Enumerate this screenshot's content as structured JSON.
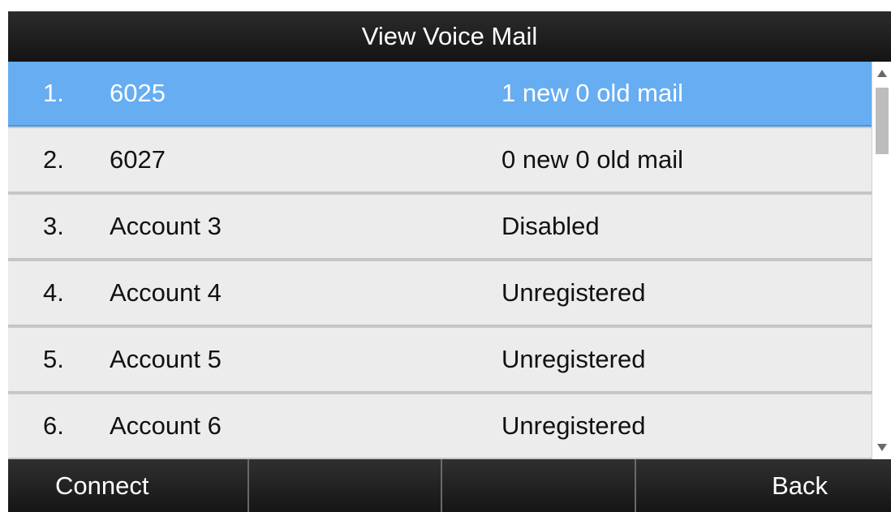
{
  "title": "View Voice Mail",
  "accounts": [
    {
      "num": "1.",
      "name": "6025",
      "status": "1 new 0 old mail",
      "selected": true
    },
    {
      "num": "2.",
      "name": "6027",
      "status": "0 new 0 old mail",
      "selected": false
    },
    {
      "num": "3.",
      "name": "Account 3",
      "status": "Disabled",
      "selected": false
    },
    {
      "num": "4.",
      "name": "Account 4",
      "status": "Unregistered",
      "selected": false
    },
    {
      "num": "5.",
      "name": "Account 5",
      "status": "Unregistered",
      "selected": false
    },
    {
      "num": "6.",
      "name": "Account 6",
      "status": "Unregistered",
      "selected": false
    }
  ],
  "softkeys": [
    "Connect",
    "",
    "",
    "Back"
  ],
  "colors": {
    "selected_row": "#66adf2",
    "row_background": "#ececec",
    "bar_background": "#1c1c1c"
  },
  "icons": [
    "scroll-up-arrow-icon",
    "scroll-down-arrow-icon"
  ]
}
